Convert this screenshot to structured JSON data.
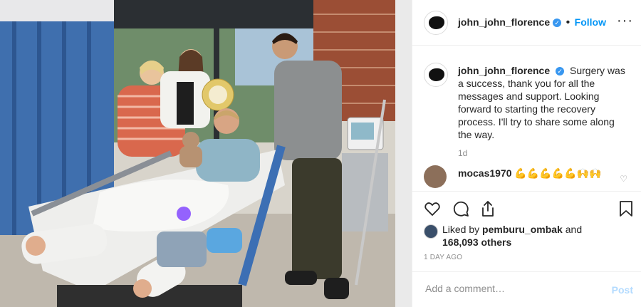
{
  "post": {
    "header": {
      "username": "john_john_florence",
      "verified_glyph": "✓",
      "separator": "•",
      "follow_label": "Follow",
      "more_glyph": "···"
    },
    "caption": {
      "username": "john_john_florence",
      "text": "Surgery was a success, thank you for all the messages and support. Looking forward to starting the recovery process. I'll try to share some along the way.",
      "time": "1d"
    },
    "comments": [
      {
        "username": "mocas1970",
        "text": "💪💪💪💪💪🙌🙌"
      }
    ],
    "likes": {
      "prefix": "Liked by",
      "user": "pemburu_ombak",
      "conjunction": "and",
      "count": "168,093 others"
    },
    "date": "1 DAY AGO",
    "add_comment": {
      "placeholder": "Add a comment…",
      "post_label": "Post"
    },
    "icons": {
      "like": "heart-icon",
      "comment": "speech-bubble-icon",
      "share": "share-icon",
      "save": "bookmark-icon"
    },
    "colors": {
      "link": "#0095f6",
      "muted": "#8e8e8e",
      "post_disabled": "#b3dbff"
    }
  }
}
